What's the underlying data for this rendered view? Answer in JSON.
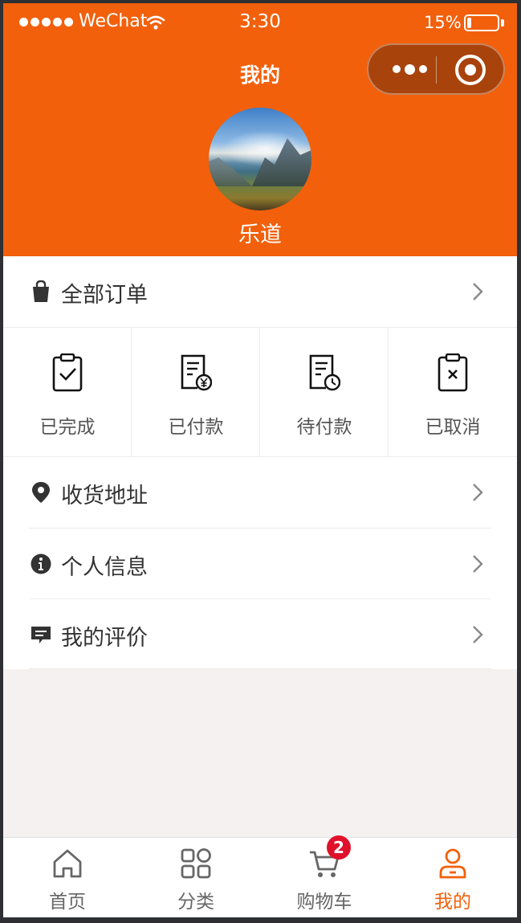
{
  "status_bar": {
    "carrier": "WeChat",
    "time": "3:30",
    "battery_percent": "15%",
    "battery_level": 0.15,
    "signal_icon": "signal-dots-icon",
    "wifi_icon": "wifi-icon"
  },
  "nav": {
    "title": "我的",
    "capsule_more_icon": "more-dots-icon",
    "capsule_close_icon": "target-circle-icon"
  },
  "profile": {
    "username": "乐道",
    "avatar_image": "landscape-photo-avatar"
  },
  "orders": {
    "label": "全部订单",
    "icon": "shopping-bag-icon",
    "statuses": [
      {
        "label": "已完成",
        "icon": "clipboard-check-icon"
      },
      {
        "label": "已付款",
        "icon": "receipt-yen-icon"
      },
      {
        "label": "待付款",
        "icon": "receipt-clock-icon"
      },
      {
        "label": "已取消",
        "icon": "clipboard-x-icon"
      }
    ]
  },
  "menu": [
    {
      "label": "收货地址",
      "icon": "location-pin-icon"
    },
    {
      "label": "个人信息",
      "icon": "info-circle-icon"
    },
    {
      "label": "我的评价",
      "icon": "comment-icon"
    }
  ],
  "tabbar": {
    "items": [
      {
        "label": "首页",
        "icon": "home-icon",
        "active": false
      },
      {
        "label": "分类",
        "icon": "grid-icon",
        "active": false
      },
      {
        "label": "购物车",
        "icon": "cart-icon",
        "active": false,
        "badge": "2"
      },
      {
        "label": "我的",
        "icon": "user-icon",
        "active": true
      }
    ]
  },
  "colors": {
    "accent": "#f2600c",
    "badge": "#e0112b",
    "background": "#f4f1f0"
  }
}
